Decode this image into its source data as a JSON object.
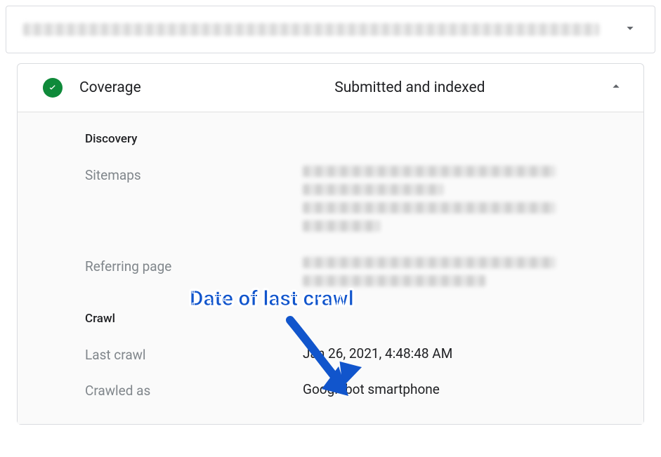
{
  "topbar": {},
  "coverage": {
    "title": "Coverage",
    "status": "Submitted and indexed"
  },
  "sections": {
    "discovery": {
      "title": "Discovery"
    },
    "crawl": {
      "title": "Crawl"
    }
  },
  "rows": {
    "sitemaps_label": "Sitemaps",
    "referring_page_label": "Referring page",
    "last_crawl_label": "Last crawl",
    "last_crawl_value": "Jan 26, 2021, 4:48:48 AM",
    "crawled_as_label": "Crawled as",
    "crawled_as_value": "Googlebot smartphone"
  },
  "annotation": {
    "text": "Date of last crawl"
  }
}
